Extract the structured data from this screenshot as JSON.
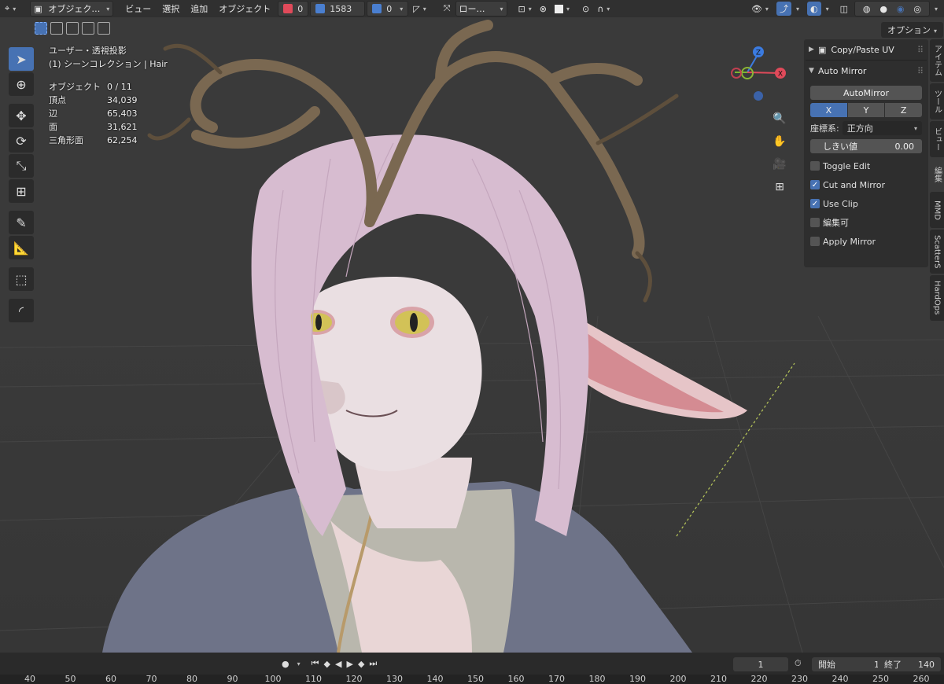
{
  "header": {
    "mode_label": "オブジェク…",
    "menus": [
      "ビュー",
      "選択",
      "追加",
      "オブジェクト"
    ],
    "stat_values": [
      "0",
      "1583",
      "0"
    ],
    "orient_label": "ロー…",
    "options_label": "オプション"
  },
  "overlay": {
    "view_name": "ユーザー・透視投影",
    "collection": "(1) シーンコレクション | Hair",
    "stats": [
      {
        "k": "オブジェクト",
        "v": "0 / 11"
      },
      {
        "k": "頂点",
        "v": "34,039"
      },
      {
        "k": "辺",
        "v": "65,403"
      },
      {
        "k": "面",
        "v": "31,621"
      },
      {
        "k": "三角形面",
        "v": "62,254"
      }
    ]
  },
  "gizmo": {
    "z": "Z",
    "x": "X"
  },
  "panel": {
    "copy_paste_uv": "Copy/Paste UV",
    "auto_mirror": "Auto Mirror",
    "automirror_btn": "AutoMirror",
    "axes": [
      "X",
      "Y",
      "Z"
    ],
    "coord_label": "座標系:",
    "coord_value": "正方向",
    "threshold_label": "しきい値",
    "threshold_value": "0.00",
    "checks": [
      {
        "label": "Toggle Edit",
        "on": false
      },
      {
        "label": "Cut and Mirror",
        "on": true
      },
      {
        "label": "Use Clip",
        "on": true
      },
      {
        "label": "編集可",
        "on": false
      },
      {
        "label": "Apply Mirror",
        "on": false
      }
    ]
  },
  "vtabs": [
    "アイテム",
    "ツール",
    "ビュー",
    "編集",
    "MMD",
    "ScatterS",
    "HardOps"
  ],
  "timeline": {
    "current_frame": "1",
    "start_label": "開始",
    "start_value": "1",
    "end_label": "終了",
    "end_value": "140",
    "ruler": [
      "40",
      "50",
      "60",
      "70",
      "80",
      "90",
      "100",
      "110",
      "120",
      "130",
      "140",
      "150",
      "160",
      "170",
      "180",
      "190",
      "200",
      "210",
      "220",
      "230",
      "240",
      "250",
      "260"
    ]
  },
  "colors": {
    "accent": "#4772b3",
    "header": "#303030",
    "viewport": "#3a3a3a"
  }
}
